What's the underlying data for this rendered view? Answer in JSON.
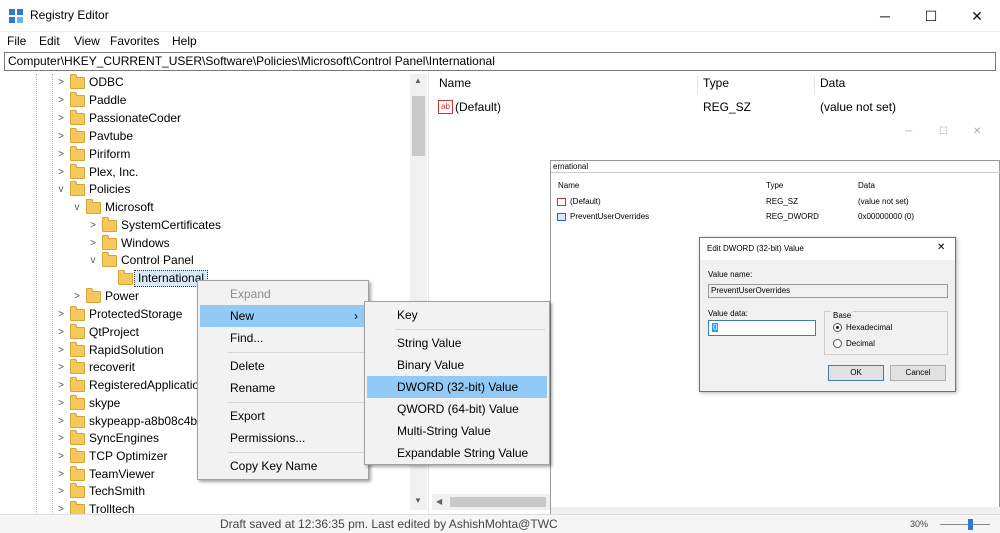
{
  "window": {
    "title": "Registry Editor",
    "min_glyph": "─",
    "max_glyph": "☐",
    "close_glyph": "✕",
    "icon": "registry-icon"
  },
  "menu": [
    "File",
    "Edit",
    "View",
    "Favorites",
    "Help"
  ],
  "address": "Computer\\HKEY_CURRENT_USER\\Software\\Policies\\Microsoft\\Control Panel\\International",
  "tree": {
    "items": [
      {
        "label": "ODBC",
        "expander": ">"
      },
      {
        "label": "Paddle",
        "expander": ">"
      },
      {
        "label": "PassionateCoder",
        "expander": ">"
      },
      {
        "label": "Pavtube",
        "expander": ">"
      },
      {
        "label": "Piriform",
        "expander": ">"
      },
      {
        "label": "Plex, Inc.",
        "expander": ">"
      },
      {
        "label": "Policies",
        "expander": "v"
      },
      {
        "label": "Microsoft",
        "expander": "v"
      },
      {
        "label": "SystemCertificates",
        "expander": ">"
      },
      {
        "label": "Windows",
        "expander": ">"
      },
      {
        "label": "Control Panel",
        "expander": "v"
      },
      {
        "label": "International",
        "expander": ""
      },
      {
        "label": "Power",
        "expander": ">"
      },
      {
        "label": "ProtectedStorage",
        "expander": ">"
      },
      {
        "label": "QtProject",
        "expander": ">"
      },
      {
        "label": "RapidSolution",
        "expander": ">"
      },
      {
        "label": "recoverit",
        "expander": ">"
      },
      {
        "label": "RegisteredApplicatio",
        "expander": ">"
      },
      {
        "label": "skype",
        "expander": ">"
      },
      {
        "label": "skypeapp-a8b08c4b9",
        "expander": ">"
      },
      {
        "label": "SyncEngines",
        "expander": ">"
      },
      {
        "label": "TCP Optimizer",
        "expander": ">"
      },
      {
        "label": "TeamViewer",
        "expander": ">"
      },
      {
        "label": "TechSmith",
        "expander": ">"
      },
      {
        "label": "Trolltech",
        "expander": ">"
      }
    ]
  },
  "values_pane": {
    "columns": {
      "name": "Name",
      "type": "Type",
      "data": "Data"
    },
    "rows": [
      {
        "name": "(Default)",
        "type": "REG_SZ",
        "data": "(value not set)",
        "icon": "ab-string-icon"
      }
    ]
  },
  "context_menu": {
    "items": [
      "Expand",
      "New",
      "Find...",
      "Delete",
      "Rename",
      "Export",
      "Permissions...",
      "Copy Key Name"
    ],
    "submenu_arrow": "›"
  },
  "new_submenu": {
    "items": [
      "Key",
      "String Value",
      "Binary Value",
      "DWORD (32-bit) Value",
      "QWORD (64-bit) Value",
      "Multi-String Value",
      "Expandable String Value"
    ]
  },
  "status": "Draft saved at 12:36:35 pm. Last edited by AshishMohta@TWC",
  "zoom": "30%",
  "overlay": {
    "address_fragment": "ernational",
    "columns": {
      "name": "Name",
      "type": "Type",
      "data": "Data"
    },
    "rows": [
      {
        "name": "(Default)",
        "type": "REG_SZ",
        "data": "(value not set)"
      },
      {
        "name": "PreventUserOverrides",
        "type": "REG_DWORD",
        "data": "0x00000000 (0)"
      }
    ],
    "dialog": {
      "title": "Edit DWORD (32-bit) Value",
      "close_glyph": "✕",
      "value_name_label": "Value name:",
      "value_name": "PreventUserOverrides",
      "value_data_label": "Value data:",
      "value_data": "0",
      "base_label": "Base",
      "hex_label": "Hexadecimal",
      "dec_label": "Decimal",
      "ok": "OK",
      "cancel": "Cancel"
    }
  },
  "colors": {
    "highlight": "#91c9f7",
    "folder": "#f4c85a",
    "dialog_border": "#3c7fb1"
  }
}
